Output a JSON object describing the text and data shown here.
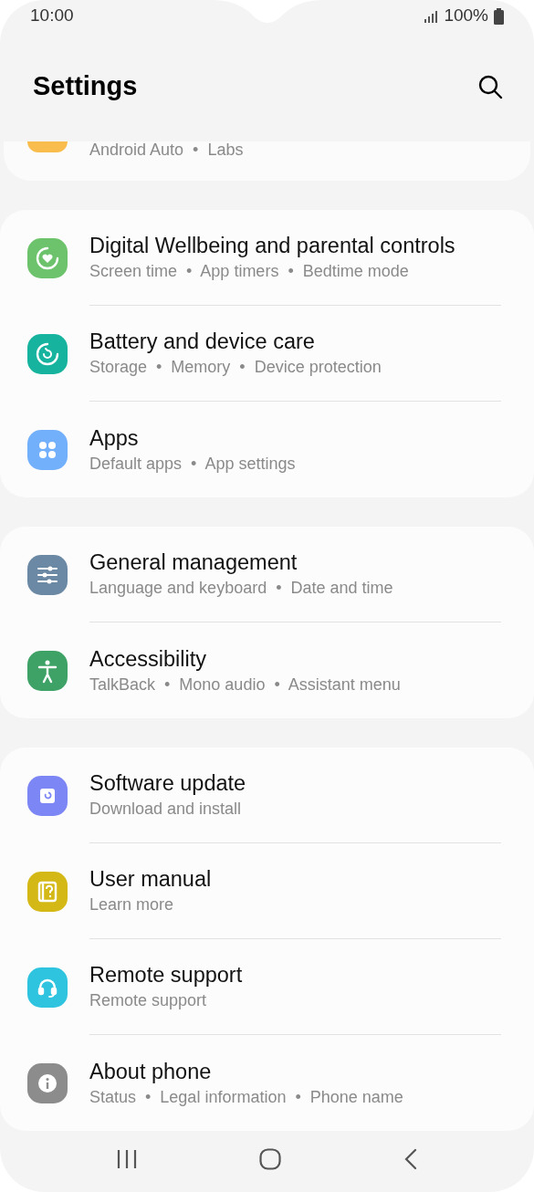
{
  "status_bar": {
    "time": "10:00",
    "battery": "100%"
  },
  "header": {
    "title": "Settings"
  },
  "partial_item": {
    "subtitle": "Android Auto  •  Labs"
  },
  "groups": [
    {
      "items": [
        {
          "kind": "wellbeing",
          "title": "Digital Wellbeing and parental controls",
          "subtitle": "Screen time  •  App timers  •  Bedtime mode"
        },
        {
          "kind": "battery",
          "title": "Battery and device care",
          "subtitle": "Storage  •  Memory  •  Device protection"
        },
        {
          "kind": "apps",
          "title": "Apps",
          "subtitle": "Default apps  •  App settings"
        }
      ]
    },
    {
      "items": [
        {
          "kind": "general",
          "title": "General management",
          "subtitle": "Language and keyboard  •  Date and time"
        },
        {
          "kind": "accessibility",
          "title": "Accessibility",
          "subtitle": "TalkBack  •  Mono audio  •  Assistant menu"
        }
      ]
    },
    {
      "items": [
        {
          "kind": "update",
          "title": "Software update",
          "subtitle": "Download and install"
        },
        {
          "kind": "manual",
          "title": "User manual",
          "subtitle": "Learn more"
        },
        {
          "kind": "remote",
          "title": "Remote support",
          "subtitle": "Remote support"
        },
        {
          "kind": "about",
          "title": "About phone",
          "subtitle": "Status  •  Legal information  •  Phone name"
        }
      ]
    }
  ]
}
